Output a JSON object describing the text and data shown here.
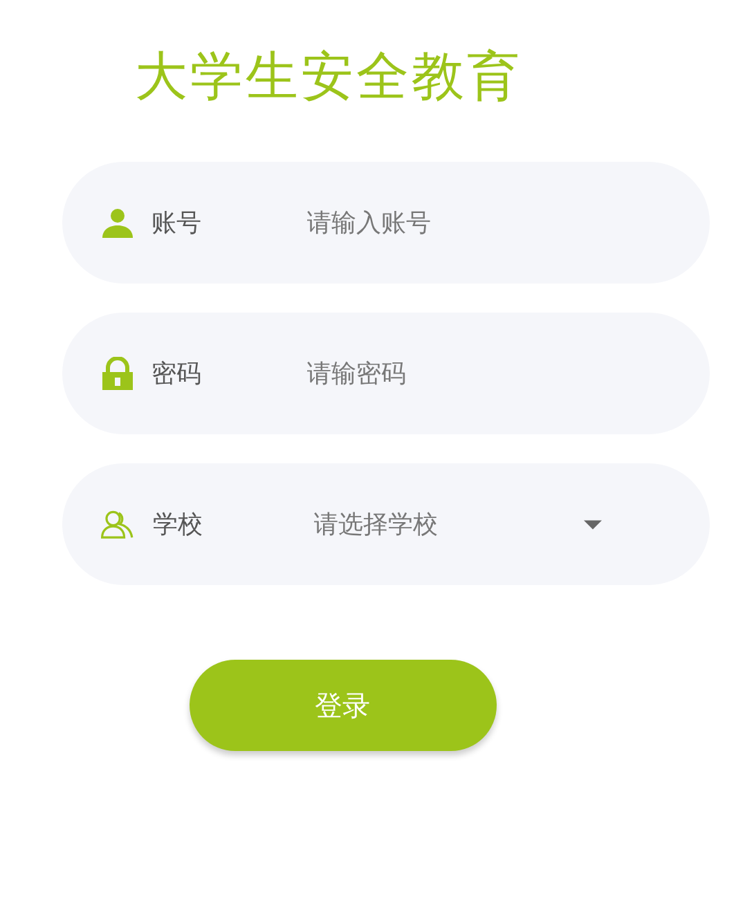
{
  "title": "大学生安全教育",
  "fields": [
    {
      "kind": "text",
      "label": "账号",
      "placeholder": "请输入账号"
    },
    {
      "kind": "password",
      "label": "密码",
      "placeholder": "请输密码"
    },
    {
      "kind": "select",
      "label": "学校",
      "placeholder": "请选择学校"
    }
  ],
  "login_button": "登录"
}
